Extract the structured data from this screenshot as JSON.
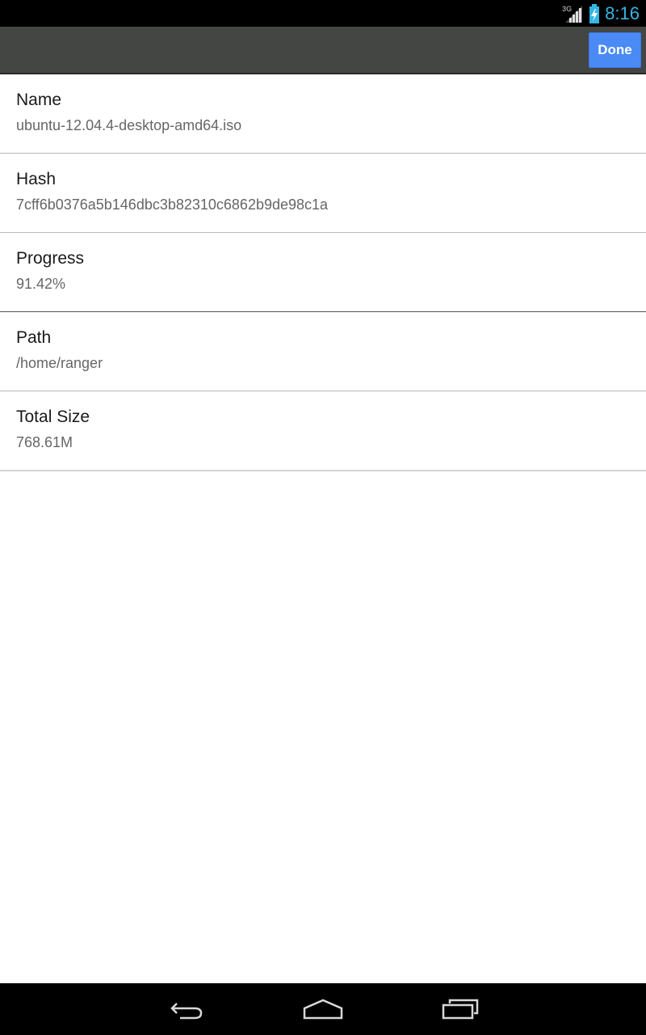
{
  "status_bar": {
    "network_type": "3G",
    "time": "8:16",
    "icons": [
      "signal-icon",
      "battery-charging-icon"
    ]
  },
  "action_bar": {
    "done_label": "Done"
  },
  "details": [
    {
      "label": "Name",
      "value": "ubuntu-12.04.4-desktop-amd64.iso"
    },
    {
      "label": "Hash",
      "value": "7cff6b0376a5b146dbc3b82310c6862b9de98c1a"
    },
    {
      "label": "Progress",
      "value": "91.42%"
    },
    {
      "label": "Path",
      "value": "/home/ranger"
    },
    {
      "label": "Total Size",
      "value": "768.61M"
    }
  ],
  "nav_bar": {
    "icons": [
      "back-icon",
      "home-icon",
      "recent-apps-icon"
    ]
  },
  "colors": {
    "accent": "#33b5e5",
    "done_button": "#4a8af4",
    "action_bar": "#444644"
  }
}
